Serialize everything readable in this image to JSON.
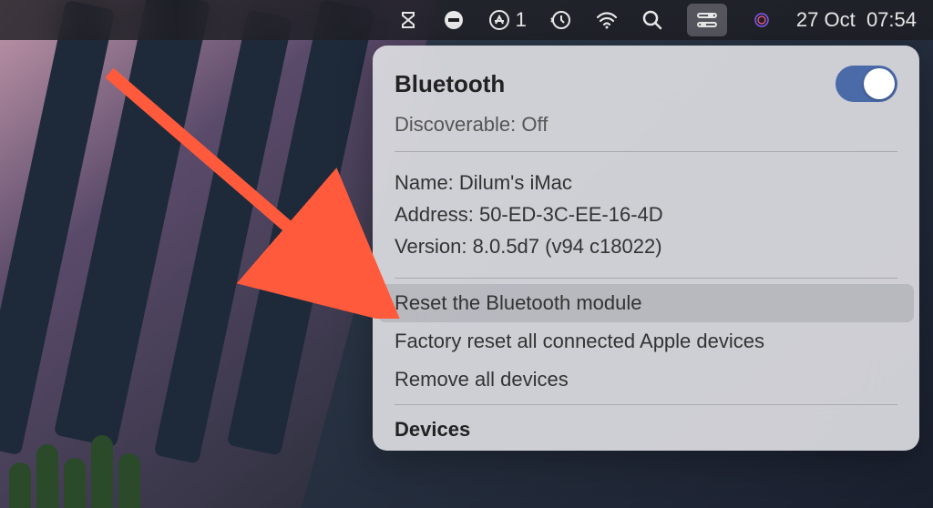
{
  "menubar": {
    "notification_badge": "1",
    "date": "27 Oct",
    "time": "07:54"
  },
  "panel": {
    "title": "Bluetooth",
    "toggle_on": true,
    "discoverable_label": "Discoverable:",
    "discoverable_value": "Off",
    "name_label": "Name:",
    "name_value": "Dilum's iMac",
    "address_label": "Address:",
    "address_value": "50-ED-3C-EE-16-4D",
    "version_label": "Version:",
    "version_value": "8.0.5d7 (v94 c18022)",
    "actions": [
      "Reset the Bluetooth module",
      "Factory reset all connected Apple devices",
      "Remove all devices"
    ],
    "devices_title": "Devices"
  }
}
